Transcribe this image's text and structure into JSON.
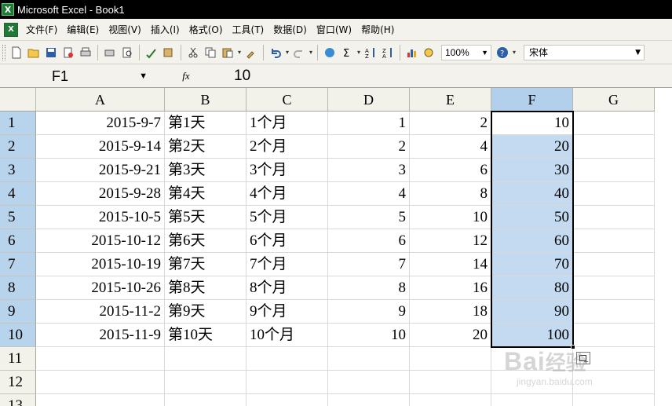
{
  "window": {
    "title": "Microsoft Excel - Book1"
  },
  "menu": [
    "文件(F)",
    "编辑(E)",
    "视图(V)",
    "插入(I)",
    "格式(O)",
    "工具(T)",
    "数据(D)",
    "窗口(W)",
    "帮助(H)"
  ],
  "toolbar": {
    "zoom": "100%",
    "font": "宋体"
  },
  "formula_bar": {
    "name_box": "F1",
    "fx_label": "fx",
    "value": "10"
  },
  "columns": [
    "A",
    "B",
    "C",
    "D",
    "E",
    "F",
    "G"
  ],
  "selected_column": "F",
  "rows": [
    {
      "num": "1",
      "A": "2015-9-7",
      "B": "第1天",
      "C": "1个月",
      "D": "1",
      "E": "2",
      "F": "10"
    },
    {
      "num": "2",
      "A": "2015-9-14",
      "B": "第2天",
      "C": "2个月",
      "D": "2",
      "E": "4",
      "F": "20"
    },
    {
      "num": "3",
      "A": "2015-9-21",
      "B": "第3天",
      "C": "3个月",
      "D": "3",
      "E": "6",
      "F": "30"
    },
    {
      "num": "4",
      "A": "2015-9-28",
      "B": "第4天",
      "C": "4个月",
      "D": "4",
      "E": "8",
      "F": "40"
    },
    {
      "num": "5",
      "A": "2015-10-5",
      "B": "第5天",
      "C": "5个月",
      "D": "5",
      "E": "10",
      "F": "50"
    },
    {
      "num": "6",
      "A": "2015-10-12",
      "B": "第6天",
      "C": "6个月",
      "D": "6",
      "E": "12",
      "F": "60"
    },
    {
      "num": "7",
      "A": "2015-10-19",
      "B": "第7天",
      "C": "7个月",
      "D": "7",
      "E": "14",
      "F": "70"
    },
    {
      "num": "8",
      "A": "2015-10-26",
      "B": "第8天",
      "C": "8个月",
      "D": "8",
      "E": "16",
      "F": "80"
    },
    {
      "num": "9",
      "A": "2015-11-2",
      "B": "第9天",
      "C": "9个月",
      "D": "9",
      "E": "18",
      "F": "90"
    },
    {
      "num": "10",
      "A": "2015-11-9",
      "B": "第10天",
      "C": "10个月",
      "D": "10",
      "E": "20",
      "F": "100"
    },
    {
      "num": "11"
    },
    {
      "num": "12"
    },
    {
      "num": "13"
    }
  ],
  "watermark": {
    "logo": "Bai",
    "cn": "经验",
    "url": "jingyan.baidu.com"
  }
}
